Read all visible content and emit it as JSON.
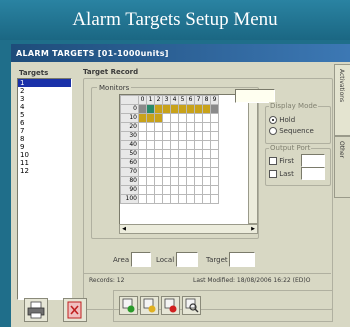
{
  "banner": {
    "title": "Alarm Targets Setup Menu"
  },
  "window": {
    "title": "ALARM TARGETS [01-1000units]"
  },
  "targets": {
    "label": "Targets",
    "items": [
      "1",
      "2",
      "3",
      "4",
      "5",
      "6",
      "7",
      "8",
      "9",
      "10",
      "11",
      "12"
    ],
    "selected_index": 0
  },
  "record": {
    "title": "Target Record",
    "monitors_label": "Monitors",
    "column_headers": [
      "0",
      "1",
      "2",
      "3",
      "4",
      "5",
      "6",
      "7",
      "8",
      "9"
    ],
    "row_headers": [
      "0",
      "10",
      "20",
      "30",
      "40",
      "50",
      "60",
      "70",
      "80",
      "90",
      "100"
    ],
    "area_label": "Area",
    "local_label": "Local",
    "target_label": "Target",
    "display_mode": {
      "label": "Display Mode",
      "options": [
        "Hold",
        "Sequence"
      ],
      "selected": "Hold"
    },
    "output_port": {
      "label": "Output Port",
      "options": [
        "First",
        "Last"
      ]
    }
  },
  "tabs": [
    "Activations",
    "Other"
  ],
  "status": {
    "records": "Records: 12",
    "last_modified": "Last Modified: 18/08/2006 16:22 (ED)O"
  },
  "colors": {
    "background": "#1f6e8a",
    "selected": "#1a30a8",
    "active_cell": "#c8a21a",
    "accent_cell": "#2a8a6a"
  },
  "icons": [
    "printer-icon",
    "exit-icon",
    "add-record-icon",
    "edit-record-icon",
    "delete-record-icon",
    "search-record-icon"
  ]
}
